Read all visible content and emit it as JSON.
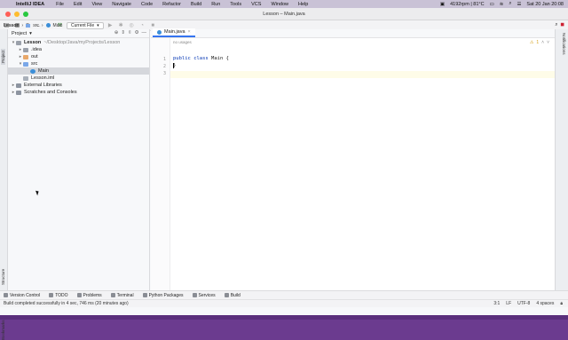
{
  "menubar": {
    "apple_icon": "apple-icon",
    "items": [
      "IntelliJ IDEA",
      "File",
      "Edit",
      "View",
      "Navigate",
      "Code",
      "Refactor",
      "Build",
      "Run",
      "Tools",
      "VCS",
      "Window",
      "Help"
    ],
    "cpu": "4192rpm | 81°C",
    "datetime": "Sat 20 Jan  20:08"
  },
  "window": {
    "title": "Lesson – Main.java",
    "traffic_colors": [
      "#ff5f57",
      "#febc2e",
      "#28c840"
    ]
  },
  "toolbar": {
    "run_config": "Current File"
  },
  "breadcrumb": [
    "Lesson",
    "src",
    "Main"
  ],
  "left_strip": {
    "project_label": "Project",
    "structure_label": "Structure",
    "bookmarks_label": "Bookmarks"
  },
  "project_panel": {
    "title": "Project",
    "tree": [
      {
        "label": "Lesson",
        "path": "~/Desktop/Java/myProjects/Lesson",
        "arrow": "▾",
        "icon": "folder-icon",
        "indent": 0,
        "bold": true
      },
      {
        "label": ".idea",
        "arrow": "▸",
        "icon": "folder-icon",
        "indent": 1
      },
      {
        "label": "out",
        "arrow": "▸",
        "icon": "folder-orange-icon",
        "indent": 1
      },
      {
        "label": "src",
        "arrow": "▾",
        "icon": "folder-blue-icon",
        "indent": 1
      },
      {
        "label": "Main",
        "arrow": "",
        "icon": "java-class-icon",
        "indent": 2,
        "selected": true
      },
      {
        "label": "Lesson.iml",
        "arrow": "",
        "icon": "iml-file-icon",
        "indent": 1
      },
      {
        "label": "External Libraries",
        "arrow": "▸",
        "icon": "library-icon",
        "indent": 0
      },
      {
        "label": "Scratches and Consoles",
        "arrow": "▸",
        "icon": "scratch-icon",
        "indent": 0
      }
    ]
  },
  "editor": {
    "tab_label": "Main.java",
    "inlay_hint": "no usages",
    "line_numbers": [
      "1",
      "2",
      "3"
    ],
    "lines": [
      {
        "kw1": "public",
        "kw2": "class",
        "rest": " Main {"
      },
      {
        "kw1": "",
        "kw2": "",
        "rest": "}"
      },
      {
        "kw1": "",
        "kw2": "",
        "rest": ""
      }
    ],
    "warnings": "1"
  },
  "right_strip": {
    "notifications_label": "Notifications"
  },
  "bottom_tools": [
    "Version Control",
    "TODO",
    "Problems",
    "Terminal",
    "Python Packages",
    "Services",
    "Build"
  ],
  "status": {
    "message": "Build completed successfully in 4 sec, 746 ms (20 minutes ago)",
    "position": "3:1",
    "line_sep": "LF",
    "encoding": "UTF-8",
    "indent": "4 spaces"
  }
}
